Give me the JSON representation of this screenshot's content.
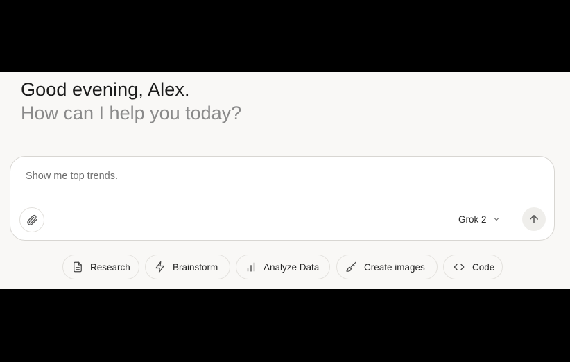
{
  "greeting": "Good evening, Alex.",
  "subgreeting": "How can I help you today?",
  "composer": {
    "placeholder": "Show me top trends.",
    "model_label": "Grok 2"
  },
  "chips": [
    {
      "label": "Research",
      "icon": "document-icon"
    },
    {
      "label": "Brainstorm",
      "icon": "lightning-icon"
    },
    {
      "label": "Analyze Data",
      "icon": "bar-chart-icon"
    },
    {
      "label": "Create images",
      "icon": "paintbrush-icon"
    },
    {
      "label": "Code",
      "icon": "code-icon"
    }
  ],
  "colors": {
    "background": "#f9f8f6",
    "text_primary": "#1b1b1b",
    "text_secondary": "#8a8a8a",
    "border": "#d8d6d2"
  }
}
